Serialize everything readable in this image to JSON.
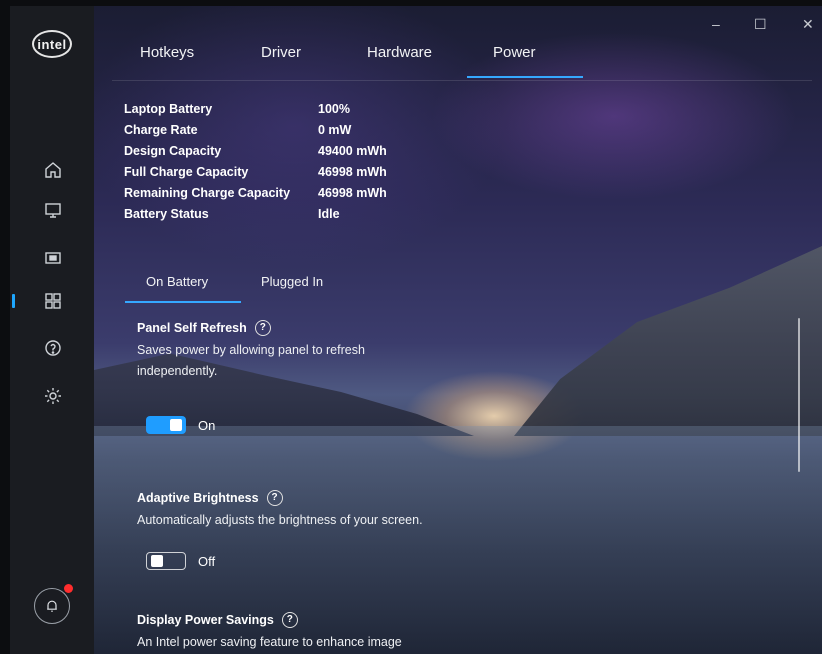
{
  "app": {
    "logo_text": "intel"
  },
  "window_controls": {
    "minimize": "–",
    "maximize": "☐",
    "close": "✕"
  },
  "sidebar": {
    "items": [
      {
        "name": "home-icon"
      },
      {
        "name": "display-icon"
      },
      {
        "name": "video-icon"
      },
      {
        "name": "apps-icon",
        "active": true
      },
      {
        "name": "help-icon"
      },
      {
        "name": "gear-icon"
      }
    ],
    "notification_icon": "bell-icon",
    "accent_color": "#1ea7ff",
    "badge_color": "#ff2d2d"
  },
  "tabs": [
    {
      "label": "Hotkeys"
    },
    {
      "label": "Driver"
    },
    {
      "label": "Hardware"
    },
    {
      "label": "Power",
      "active": true
    }
  ],
  "battery_info": [
    {
      "label": "Laptop Battery",
      "value": "100%"
    },
    {
      "label": "Charge Rate",
      "value": "0 mW"
    },
    {
      "label": "Design Capacity",
      "value": "49400 mWh"
    },
    {
      "label": "Full Charge Capacity",
      "value": "46998 mWh"
    },
    {
      "label": "Remaining Charge Capacity",
      "value": "46998 mWh"
    },
    {
      "label": "Battery Status",
      "value": "Idle"
    }
  ],
  "subtabs": [
    {
      "label": "On Battery",
      "active": true
    },
    {
      "label": "Plugged In"
    }
  ],
  "settings": [
    {
      "title": "Panel Self Refresh",
      "description": "Saves power by allowing panel to refresh independently.",
      "state": "On",
      "enabled": true
    },
    {
      "title": "Adaptive Brightness",
      "description": "Automatically adjusts the brightness of your screen.",
      "state": "Off",
      "enabled": false
    },
    {
      "title": "Display Power Savings",
      "description": "An Intel power saving feature to enhance image"
    }
  ],
  "colors": {
    "toggle_on": "#1f9dff",
    "tab_underline": "#35a8ff"
  }
}
